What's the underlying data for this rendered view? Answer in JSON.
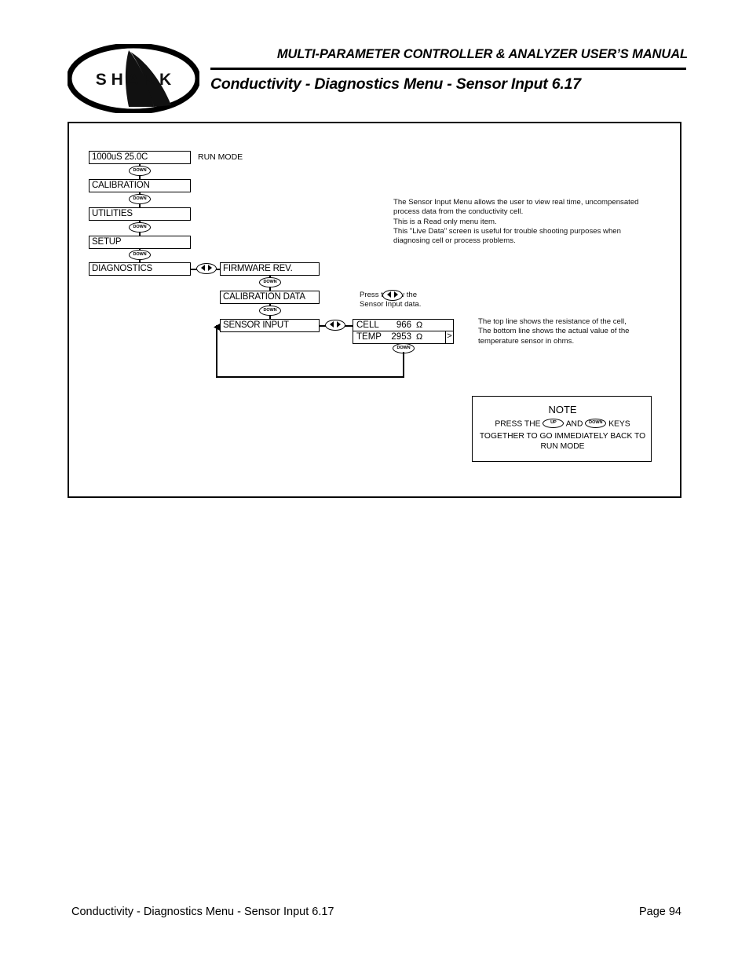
{
  "header": {
    "title": "MULTI-PARAMETER CONTROLLER & ANALYZER USER’S MANUAL",
    "subtitle": "Conductivity - Diagnostics Menu - Sensor Input 6.17",
    "logo_text": "S H A R K",
    "logo_name": "shark-logo"
  },
  "flow": {
    "run_mode_label": "RUN MODE",
    "left_column": [
      {
        "label": "1000uS  25.0C"
      },
      {
        "label": "CALIBRATION"
      },
      {
        "label": "UTILITIES"
      },
      {
        "label": "SETUP"
      },
      {
        "label": "DIAGNOSTICS"
      }
    ],
    "right_column": [
      {
        "label": "FIRMWARE REV."
      },
      {
        "label": "CALIBRATION DATA"
      },
      {
        "label": "SENSOR INPUT"
      }
    ],
    "keys": {
      "down": "DOWN",
      "up": "UP",
      "left_right": "left-right-arrow"
    },
    "lcd": {
      "row1": {
        "label": "CELL",
        "value": "966",
        "unit": "Ω"
      },
      "row2": {
        "label": "TEMP",
        "value": "2953",
        "unit": "Ω",
        "more": ">"
      }
    }
  },
  "descriptions": {
    "sensor_input_menu": "The Sensor Input Menu allows the user to view real time, uncompensated\nprocess data from the conductivity cell.\nThis is a Read only menu item.\nThis \"Live Data\" screen is useful for trouble shooting purposes when\ndiagnosing cell or process problems.",
    "press_hint": "Press           to view the\nSensor Input data.",
    "lines_hint": "The top line shows the resistance of the cell,\nThe bottom line shows the actual value of the\ntemperature sensor in ohms."
  },
  "note": {
    "title": "NOTE",
    "line1_before": "PRESS THE",
    "key_up": "UP",
    "line1_mid": "AND",
    "key_down": "DOWN",
    "line1_after": "KEYS",
    "line2": "TOGETHER TO GO IMMEDIATELY BACK TO",
    "line3": "RUN MODE"
  },
  "footer": {
    "left": "Conductivity - Diagnostics Menu - Sensor Input 6.17",
    "right": "Page 94"
  }
}
